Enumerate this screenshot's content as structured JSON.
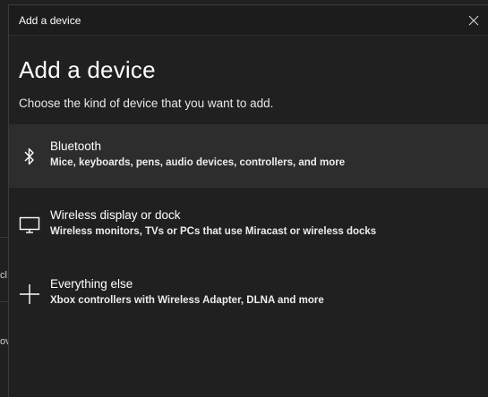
{
  "window": {
    "title": "Add a device"
  },
  "header": {
    "heading": "Add a device",
    "subheading": "Choose the kind of device that you want to add."
  },
  "options": [
    {
      "icon": "bluetooth-icon",
      "title": "Bluetooth",
      "description": "Mice, keyboards, pens, audio devices, controllers, and more",
      "selected": true
    },
    {
      "icon": "monitor-icon",
      "title": "Wireless display or dock",
      "description": "Wireless monitors, TVs or PCs that use Miracast or wireless docks",
      "selected": false
    },
    {
      "icon": "plus-icon",
      "title": "Everything else",
      "description": "Xbox controllers with Wireless Adapter, DLNA and more",
      "selected": false
    }
  ],
  "background_fragments": {
    "fragment_1": "cl",
    "fragment_2": "ov"
  },
  "colors": {
    "dialog_background": "#202020",
    "titlebar_background": "#1c1c1c",
    "selected_row": "#2d2d2d"
  }
}
